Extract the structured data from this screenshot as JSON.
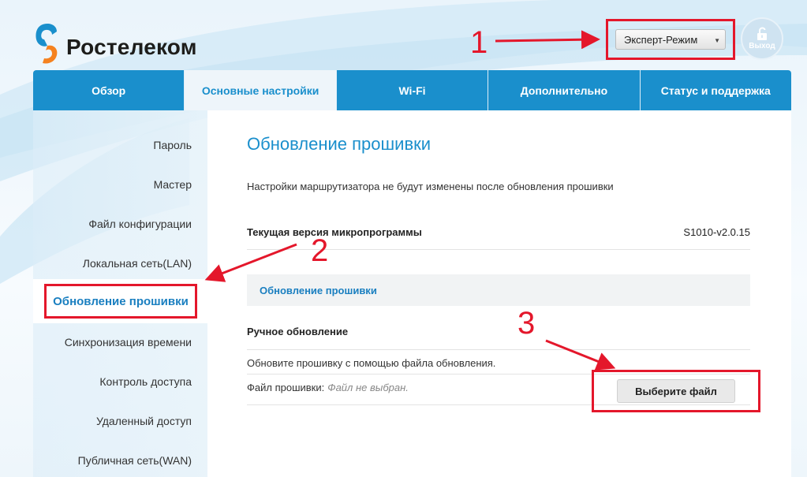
{
  "brand": {
    "name": "Ростелеком",
    "accent": "#1a8fcc",
    "logo_orange": "#f58220",
    "logo_blue": "#1a8fcc"
  },
  "header": {
    "mode_select": {
      "value": "Эксперт-Режим"
    },
    "logout_label": "Выход",
    "logout_icon": "unlock-icon"
  },
  "nav": {
    "tabs": [
      {
        "label": "Обзор",
        "active": false
      },
      {
        "label": "Основные настройки",
        "active": true
      },
      {
        "label": "Wi-Fi",
        "active": false
      },
      {
        "label": "Дополнительно",
        "active": false
      },
      {
        "label": "Статус и поддержка",
        "active": false
      }
    ]
  },
  "sidebar": {
    "items": [
      {
        "label": "Пароль"
      },
      {
        "label": "Мастер"
      },
      {
        "label": "Файл конфигурации"
      },
      {
        "label": "Локальная сеть(LAN)"
      },
      {
        "label": "Обновление прошивки",
        "active": true
      },
      {
        "label": "Синхронизация времени"
      },
      {
        "label": "Контроль доступа"
      },
      {
        "label": "Удаленный доступ"
      },
      {
        "label": "Публичная сеть(WAN)"
      }
    ]
  },
  "main": {
    "title": "Обновление прошивки",
    "note": "Настройки маршрутизатора не будут изменены после обновления прошивки",
    "current_version_label": "Текущая версия микропрограммы",
    "current_version_value": "S1010-v2.0.15",
    "section_heading": "Обновление прошивки",
    "manual_heading": "Ручное обновление",
    "manual_hint": "Обновите прошивку с помощью файла обновления.",
    "file_label": "Файл прошивки:",
    "file_none": "Файл не выбран.",
    "choose_file_button": "Выберите файл"
  },
  "annotations": {
    "step1": "1",
    "step2": "2",
    "step3": "3",
    "color": "#e4172b"
  }
}
